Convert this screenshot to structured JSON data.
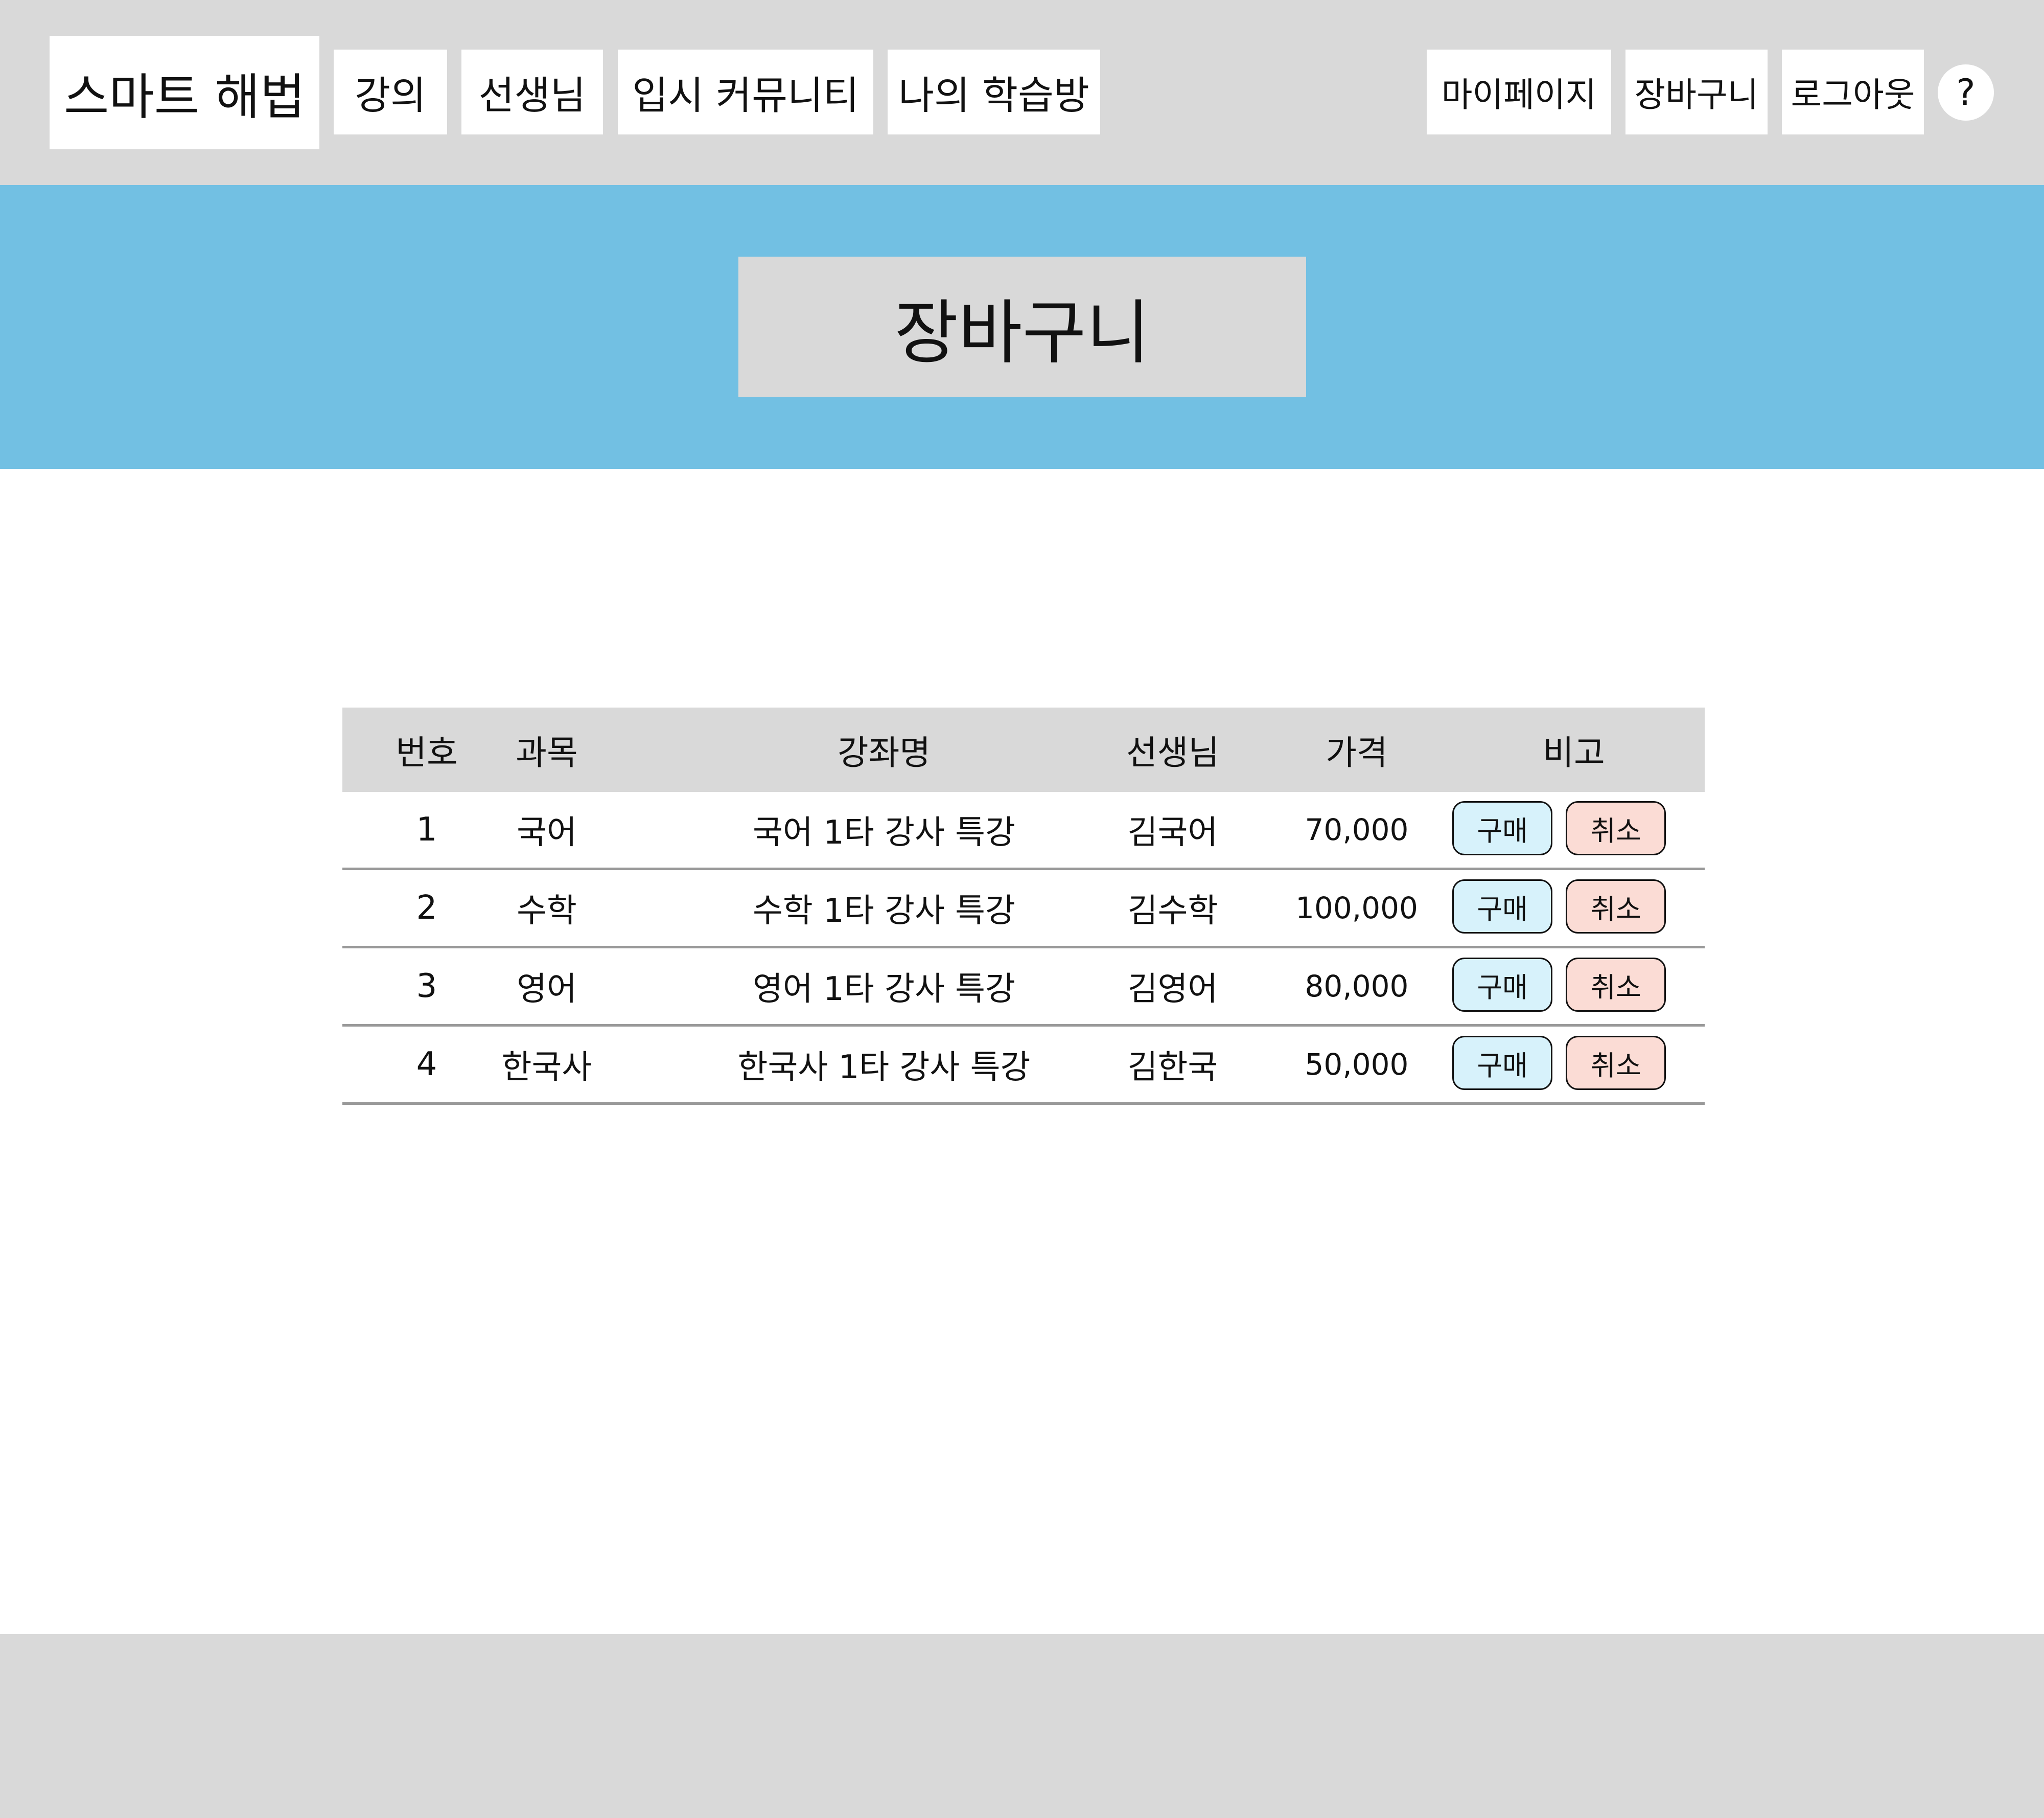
{
  "header": {
    "logo": "스마트 해법",
    "nav_left": [
      "강의",
      "선생님",
      "입시 커뮤니티",
      "나의 학습방"
    ],
    "nav_right": [
      "마이페이지",
      "장바구니",
      "로그아웃"
    ],
    "help": "?"
  },
  "banner": {
    "title": "장바구니"
  },
  "cart": {
    "columns": [
      "번호",
      "과목",
      "강좌명",
      "선생님",
      "가격",
      "비고"
    ],
    "rows": [
      {
        "num": "1",
        "subject": "국어",
        "course": "국어 1타 강사 특강",
        "teacher": "김국어",
        "price": "70,000"
      },
      {
        "num": "2",
        "subject": "수학",
        "course": "수학 1타 강사 특강",
        "teacher": "김수학",
        "price": "100,000"
      },
      {
        "num": "3",
        "subject": "영어",
        "course": "영어 1타 강사 특강",
        "teacher": "김영어",
        "price": "80,000"
      },
      {
        "num": "4",
        "subject": "한국사",
        "course": "한국사 1타 강사 특강",
        "teacher": "김한국",
        "price": "50,000"
      }
    ],
    "buy_label": "구매",
    "cancel_label": "취소"
  },
  "colors": {
    "header_bg": "#d9d9d9",
    "banner_bg": "#72c0e3",
    "buy_bg": "#d7f2fb",
    "cancel_bg": "#fbdcd5"
  }
}
